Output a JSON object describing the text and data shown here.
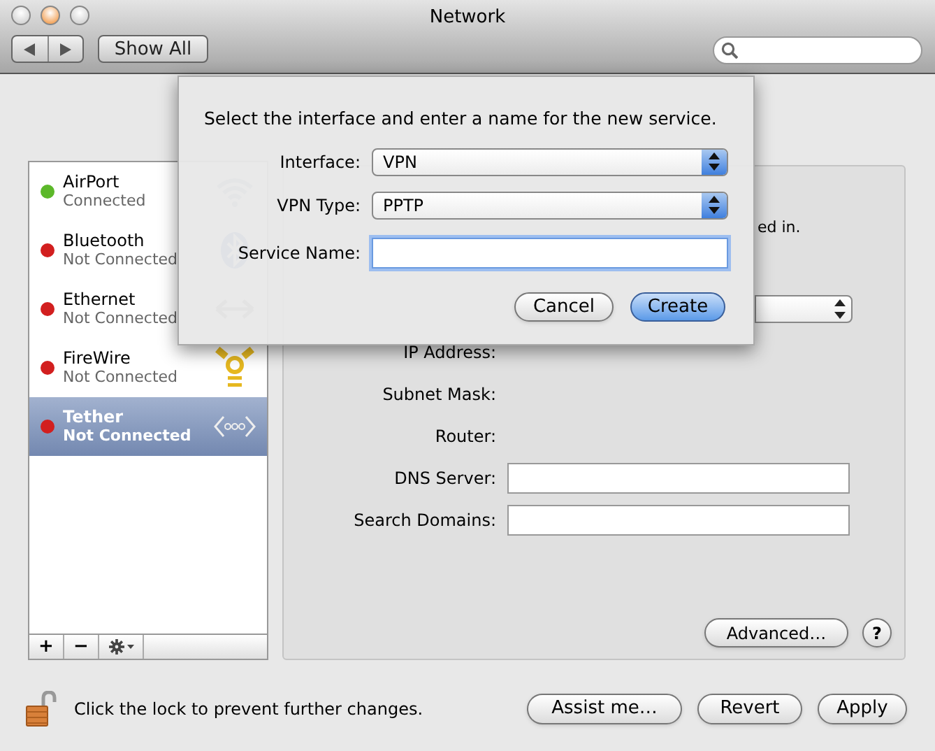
{
  "window": {
    "title": "Network"
  },
  "toolbar": {
    "show_all": "Show All"
  },
  "services": [
    {
      "name": "AirPort",
      "status": "Connected",
      "color": "#5cb82a",
      "selected": false,
      "kind": "wifi"
    },
    {
      "name": "Bluetooth",
      "status": "Not Connected",
      "color": "#d21f1f",
      "selected": false,
      "kind": "bluetooth"
    },
    {
      "name": "Ethernet",
      "status": "Not Connected",
      "color": "#d21f1f",
      "selected": false,
      "kind": "ethernet"
    },
    {
      "name": "FireWire",
      "status": "Not Connected",
      "color": "#d21f1f",
      "selected": false,
      "kind": "firewire"
    },
    {
      "name": "Tether",
      "status": "Not Connected",
      "color": "#d21f1f",
      "selected": true,
      "kind": "tether"
    }
  ],
  "list_buttons": [
    "+",
    "−"
  ],
  "panel": {
    "partial_text": "ed in.",
    "fields": [
      {
        "label": "IP Address:",
        "kind": "static"
      },
      {
        "label": "Subnet Mask:",
        "kind": "static"
      },
      {
        "label": "Router:",
        "kind": "static"
      },
      {
        "label": "DNS Server:",
        "kind": "input"
      },
      {
        "label": "Search Domains:",
        "kind": "input"
      }
    ],
    "advanced": "Advanced…",
    "help": "?"
  },
  "lock_text": "Click the lock to prevent further changes.",
  "buttons": [
    "Assist me…",
    "Revert",
    "Apply"
  ],
  "dialog": {
    "prompt": "Select the interface and enter a name for the new service.",
    "rows": [
      {
        "label": "Interface:",
        "kind": "popup",
        "value": "VPN"
      },
      {
        "label": "VPN Type:",
        "kind": "popup",
        "value": "PPTP"
      },
      {
        "label": "Service Name:",
        "kind": "input",
        "focused": true
      }
    ],
    "buttons": [
      {
        "label": "Cancel",
        "default": false
      },
      {
        "label": "Create",
        "default": true
      }
    ]
  }
}
